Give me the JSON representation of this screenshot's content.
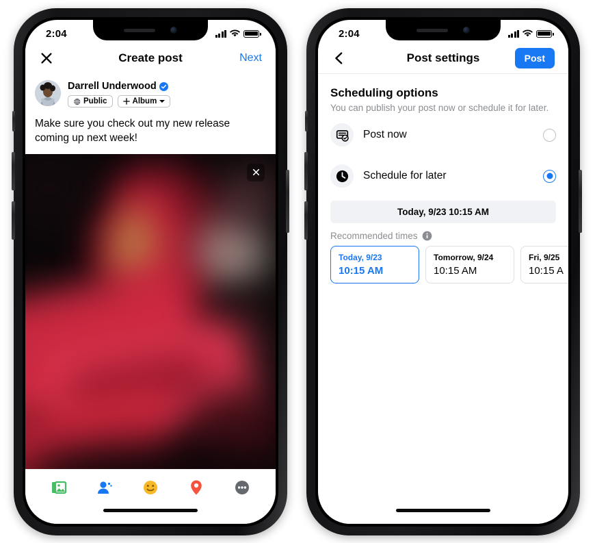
{
  "left_phone": {
    "status_bar": {
      "time": "2:04",
      "signal_icon": "cellular-signal-icon",
      "wifi_icon": "wifi-icon",
      "battery_icon": "battery-icon"
    },
    "nav": {
      "close_icon": "close-icon",
      "title": "Create post",
      "next_label": "Next"
    },
    "composer": {
      "avatar_name": "avatar",
      "author": "Darrell Underwood",
      "verified_icon": "verified-badge-icon",
      "audience_chip": {
        "label": "Public",
        "icon": "globe-icon"
      },
      "album_chip": {
        "label": "Album",
        "plus_icon": "plus-icon",
        "caret_icon": "chevron-down-icon"
      },
      "text": "Make sure you check out my new release coming up next week!"
    },
    "media": {
      "close_icon": "close-icon",
      "alt": "blurred dark photo of red ticket stubs with stars"
    },
    "toolbar": [
      {
        "name": "photo-video-icon",
        "label": "Photo/Video",
        "color": "#45BD62"
      },
      {
        "name": "tag-people-icon",
        "label": "Tag People",
        "color": "#1877F2"
      },
      {
        "name": "feeling-activity-icon",
        "label": "Feeling/Activity",
        "color": "#F7B928"
      },
      {
        "name": "check-in-icon",
        "label": "Check in",
        "color": "#F5533D"
      },
      {
        "name": "more-options-icon",
        "label": "More",
        "color": "#65686C"
      }
    ]
  },
  "right_phone": {
    "status_bar": {
      "time": "2:04",
      "signal_icon": "cellular-signal-icon",
      "wifi_icon": "wifi-icon",
      "battery_icon": "battery-icon"
    },
    "nav": {
      "back_icon": "back-chevron-icon",
      "title": "Post settings",
      "post_label": "Post"
    },
    "settings": {
      "section_title": "Scheduling options",
      "section_sub": "You can publish your post now or schedule it for later.",
      "options": [
        {
          "label": "Post now",
          "icon": "post-now-icon",
          "selected": false
        },
        {
          "label": "Schedule for later",
          "icon": "clock-icon",
          "selected": true
        }
      ],
      "datetime_value": "Today, 9/23 10:15 AM",
      "recommended_label": "Recommended times",
      "info_icon": "info-icon",
      "recommended_times": [
        {
          "day": "Today, 9/23",
          "time": "10:15 AM",
          "selected": true
        },
        {
          "day": "Tomorrow, 9/24",
          "time": "10:15 AM",
          "selected": false
        },
        {
          "day": "Fri, 9/25",
          "time": "10:15 A",
          "selected": false
        }
      ]
    }
  },
  "colors": {
    "accent": "#1877F2",
    "text": "#050505",
    "muted": "#8a8d91",
    "field_bg": "#f0f2f5"
  }
}
